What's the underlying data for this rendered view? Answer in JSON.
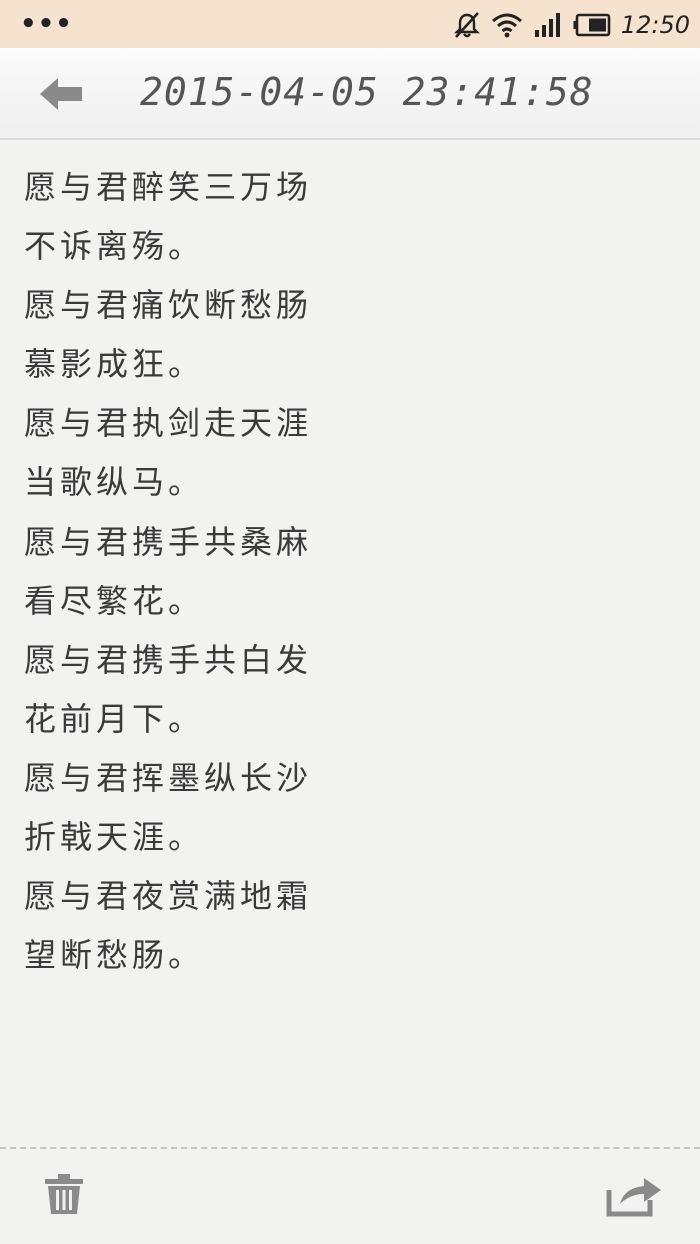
{
  "status_bar": {
    "menu_dots": "•••",
    "time": "12:50",
    "icons": [
      "notifications-muted-icon",
      "wifi-icon",
      "signal-icon",
      "battery-icon"
    ]
  },
  "header": {
    "back_icon": "arrow-left-icon",
    "title": "2015-04-05 23:41:58"
  },
  "note": {
    "lines": [
      "愿与君醉笑三万场",
      "不诉离殇。",
      "愿与君痛饮断愁肠",
      "慕影成狂。",
      "愿与君执剑走天涯",
      "当歌纵马。",
      "愿与君携手共桑麻",
      "看尽繁花。",
      "愿与君携手共白发",
      "花前月下。",
      "愿与君挥墨纵长沙",
      "折戟天涯。",
      "愿与君夜赏满地霜",
      "望断愁肠。"
    ]
  },
  "footer": {
    "delete_icon": "trash-icon",
    "share_icon": "share-icon"
  },
  "colors": {
    "status_bar_bg": "#f5e3cf",
    "page_bg": "#f2f2f1",
    "text": "#3a3a3a",
    "icon_gray": "#8a8a8a"
  }
}
